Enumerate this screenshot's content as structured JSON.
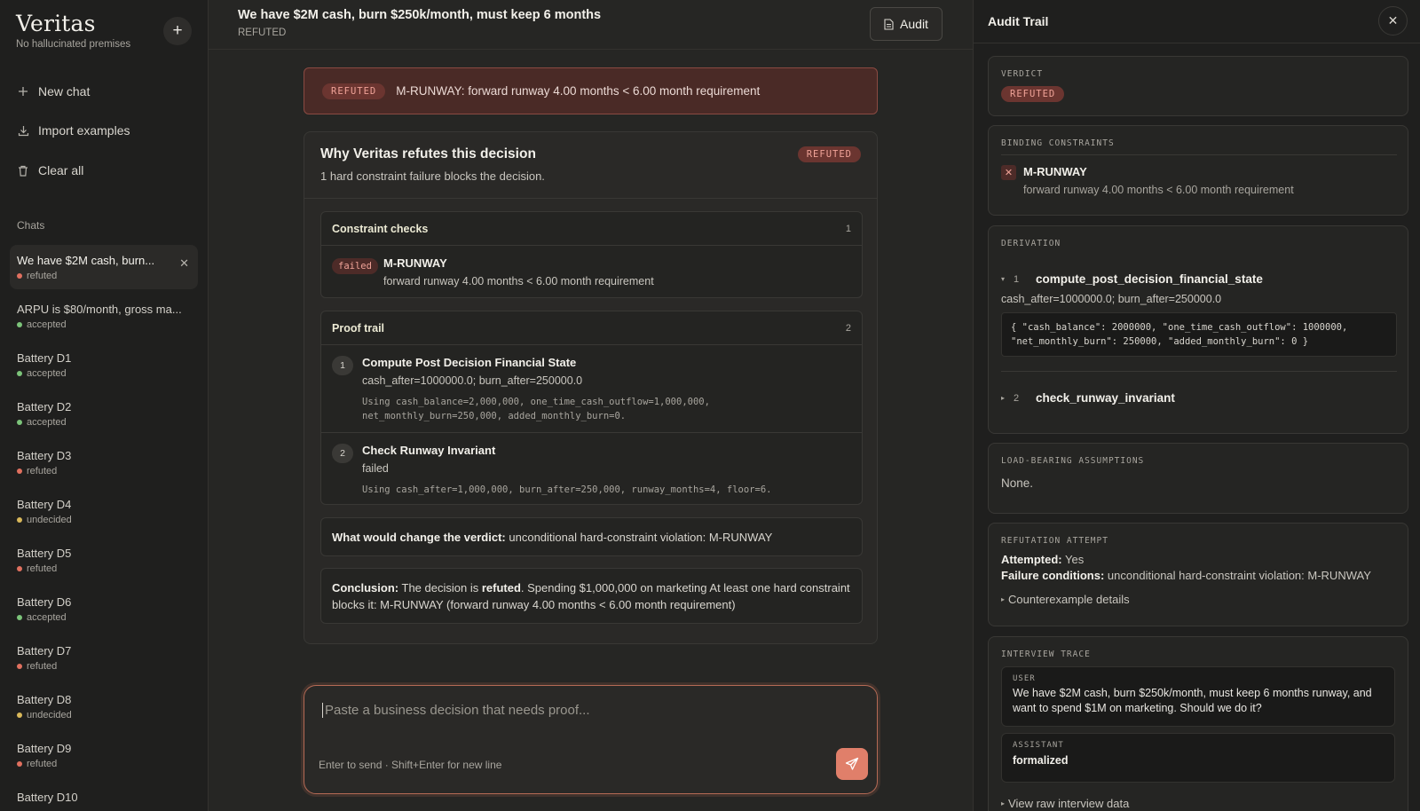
{
  "sidebar": {
    "brand": "Veritas",
    "tagline": "No hallucinated premises",
    "new_chat": "New chat",
    "import_examples": "Import examples",
    "clear_all": "Clear all",
    "chats_label": "Chats",
    "chats": [
      {
        "title": "We have $2M cash, burn...",
        "status": "refuted",
        "color": "#e0705f"
      },
      {
        "title": "ARPU is $80/month, gross ma...",
        "status": "accepted",
        "color": "#7cc47a"
      },
      {
        "title": "Battery D1",
        "status": "accepted",
        "color": "#7cc47a"
      },
      {
        "title": "Battery D2",
        "status": "accepted",
        "color": "#7cc47a"
      },
      {
        "title": "Battery D3",
        "status": "refuted",
        "color": "#e0705f"
      },
      {
        "title": "Battery D4",
        "status": "undecided",
        "color": "#d9b85a"
      },
      {
        "title": "Battery D5",
        "status": "refuted",
        "color": "#e0705f"
      },
      {
        "title": "Battery D6",
        "status": "accepted",
        "color": "#7cc47a"
      },
      {
        "title": "Battery D7",
        "status": "refuted",
        "color": "#e0705f"
      },
      {
        "title": "Battery D8",
        "status": "undecided",
        "color": "#d9b85a"
      },
      {
        "title": "Battery D9",
        "status": "refuted",
        "color": "#e0705f"
      },
      {
        "title": "Battery D10",
        "status": "",
        "color": ""
      }
    ]
  },
  "main": {
    "title": "We have $2M cash, burn $250k/month, must keep 6 months",
    "status": "REFUTED",
    "audit_label": "Audit",
    "banner": {
      "pill": "REFUTED",
      "text": "M-RUNWAY: forward runway 4.00 months < 6.00 month requirement"
    },
    "card": {
      "title": "Why Veritas refutes this decision",
      "subtitle": "1 hard constraint failure blocks the decision.",
      "pill": "REFUTED",
      "constraints": {
        "label": "Constraint checks",
        "count": "1",
        "item": {
          "pill": "failed",
          "name": "M-RUNWAY",
          "detail": "forward runway 4.00 months < 6.00 month requirement"
        }
      },
      "proof": {
        "label": "Proof trail",
        "count": "2",
        "steps": [
          {
            "num": "1",
            "title": "Compute Post Decision Financial State",
            "sub": "cash_after=1000000.0; burn_after=250000.0",
            "mono1": "Using cash_balance=2,000,000, one_time_cash_outflow=1,000,000,",
            "mono2": "net_monthly_burn=250,000, added_monthly_burn=0."
          },
          {
            "num": "2",
            "title": "Check Runway Invariant",
            "sub": "failed",
            "mono1": "Using cash_after=1,000,000, burn_after=250,000, runway_months=4, floor=6."
          }
        ]
      },
      "change": {
        "label": "What would change the verdict:",
        "text": "unconditional hard-constraint violation: M-RUNWAY"
      },
      "conclusion": {
        "label": "Conclusion:",
        "pre": "The decision is",
        "bold": "refuted",
        "post": ". Spending $1,000,000 on marketing At least one hard constraint blocks it: M-RUNWAY (forward runway 4.00 months < 6.00 month requirement)"
      }
    },
    "composer": {
      "placeholder": "Paste a business decision that needs proof...",
      "hint": "Enter to send · Shift+Enter for new line"
    }
  },
  "audit": {
    "title": "Audit Trail",
    "verdict": {
      "label": "VERDICT",
      "value": "REFUTED"
    },
    "binding": {
      "label": "BINDING CONSTRAINTS",
      "name": "M-RUNWAY",
      "detail": "forward runway 4.00 months < 6.00 month requirement"
    },
    "derivation": {
      "label": "DERIVATION",
      "steps": [
        {
          "num": "1",
          "name": "compute_post_decision_financial_state",
          "sub": "cash_after=1000000.0; burn_after=250000.0",
          "code1": "{ \"cash_balance\": 2000000, \"one_time_cash_outflow\": 1000000,",
          "code2": "\"net_monthly_burn\": 250000, \"added_monthly_burn\": 0 }"
        },
        {
          "num": "2",
          "name": "check_runway_invariant"
        }
      ]
    },
    "assumptions": {
      "label": "LOAD-BEARING ASSUMPTIONS",
      "value": "None."
    },
    "refutation": {
      "label": "REFUTATION ATTEMPT",
      "attempted_label": "Attempted:",
      "attempted_value": "Yes",
      "failure_label": "Failure conditions:",
      "failure_value": "unconditional hard-constraint violation: M-RUNWAY",
      "counterexample": "Counterexample details"
    },
    "interview": {
      "label": "INTERVIEW TRACE",
      "user_label": "USER",
      "user_text": "We have $2M cash, burn $250k/month, must keep 6 months runway, and want to spend $1M on marketing. Should we do it?",
      "assistant_label": "ASSISTANT",
      "assistant_text": "formalized",
      "raw": "View raw interview data"
    }
  }
}
